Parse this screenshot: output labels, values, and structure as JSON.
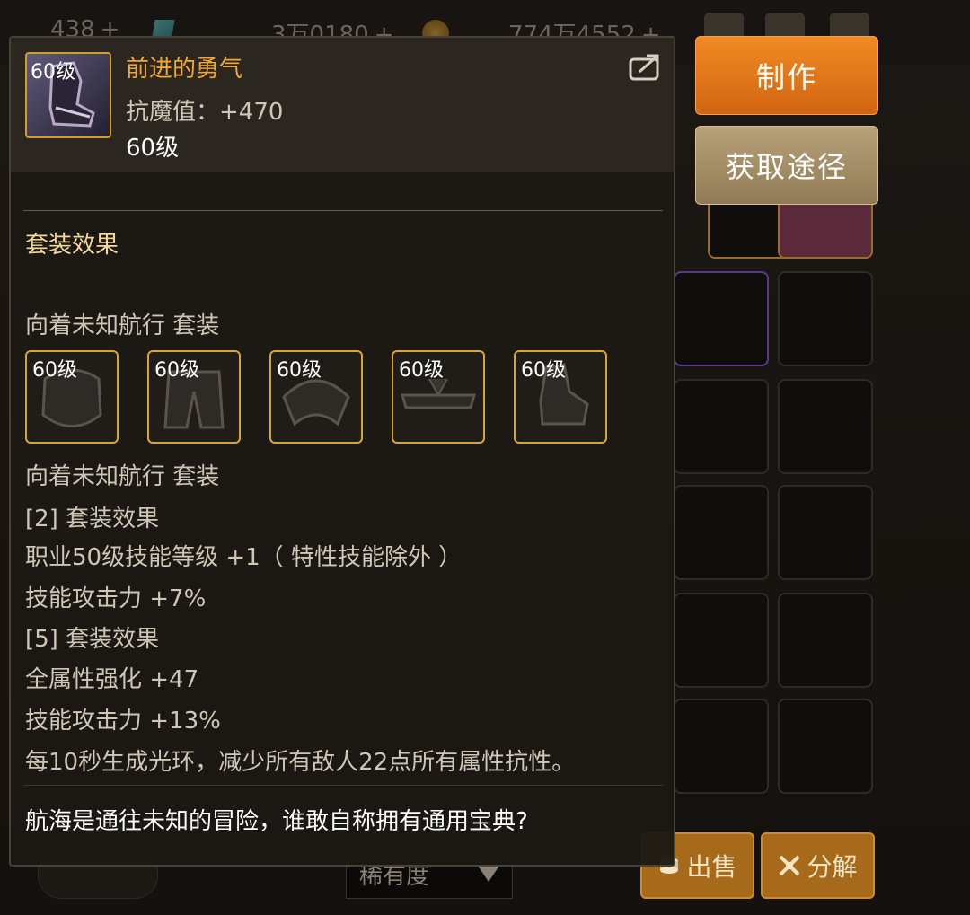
{
  "topbar": {
    "currency1": "438",
    "currency2": "3万0180",
    "currency3": "774万4552",
    "plus": "+"
  },
  "tooltip": {
    "item": {
      "level_badge": "60级",
      "name": "前进的勇气",
      "stat": "抗魔值：+470",
      "level": "60级"
    },
    "section_title": "套装效果",
    "set_name_top": "向着未知航行 套装",
    "set_pieces": [
      {
        "level_badge": "60级"
      },
      {
        "level_badge": "60级"
      },
      {
        "level_badge": "60级"
      },
      {
        "level_badge": "60级"
      },
      {
        "level_badge": "60级"
      }
    ],
    "set_name_bottom": "向着未知航行 套装",
    "effects": [
      "[2] 套装效果",
      "职业50级技能等级 +1（ 特性技能除外 ）",
      "技能攻击力 +7%",
      "[5] 套装效果",
      "全属性强化 +47",
      "技能攻击力 +13%",
      "每10秒生成光环，减少所有敌人22点所有属性抗性。"
    ],
    "flavor": "航海是通往未知的冒险，谁敢自称拥有通用宝典?"
  },
  "buttons": {
    "make": "制作",
    "source": "获取途径",
    "sell": "出售",
    "disassemble": "分解"
  },
  "rarity_select": "稀有度",
  "icons": {
    "share": "share-icon",
    "sell": "coin-stack-icon",
    "disassemble": "disassemble-icon",
    "dropdown": "triangle-down-icon"
  },
  "colors": {
    "item_name": "#f0a830",
    "make_button": "#e27818",
    "source_button": "#a58e66",
    "border_gold": "#d79a2b"
  }
}
